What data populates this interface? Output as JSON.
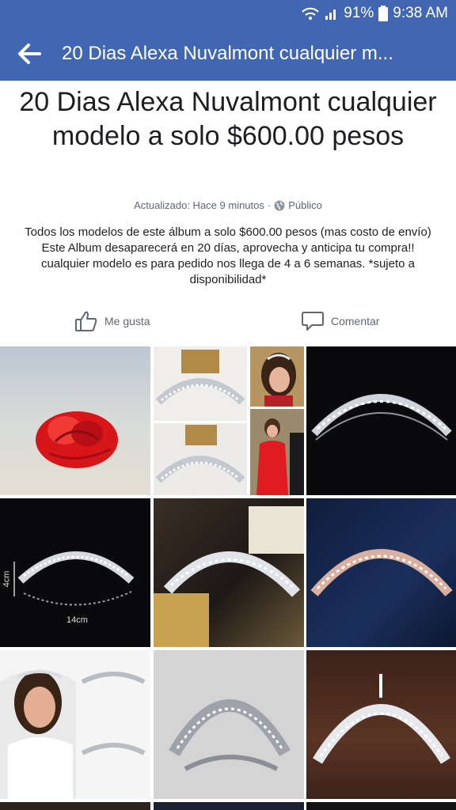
{
  "status_bar": {
    "battery": "91%",
    "time": "9:38 AM"
  },
  "app_bar": {
    "back_icon": "arrow-left-icon",
    "title": "20 Dias Alexa Nuvalmont cualquier m..."
  },
  "album": {
    "title": "20 Dias Alexa Nuvalmont cualquier modelo a solo $600.00 pesos",
    "updated": "Actualizado: Hace 9 minutos",
    "separator": "·",
    "privacy": "Público",
    "description": "Todos los modelos de este álbum a solo $600.00 pesos (mas costo de envío) Este Album desaparecerá en 20 días, aprovecha y anticipa tu compra!! cualquier modelo es para pedido nos llega de 4 a 6 semanas. *sujeto a disponibilidad*"
  },
  "actions": {
    "like": "Me gusta",
    "comment": "Comentar"
  },
  "photo_labels": {
    "height": "4cm",
    "width": "14cm"
  },
  "colors": {
    "facebook_blue": "#4267b2",
    "text_dark": "#1c1e21",
    "text_gray": "#606770"
  }
}
